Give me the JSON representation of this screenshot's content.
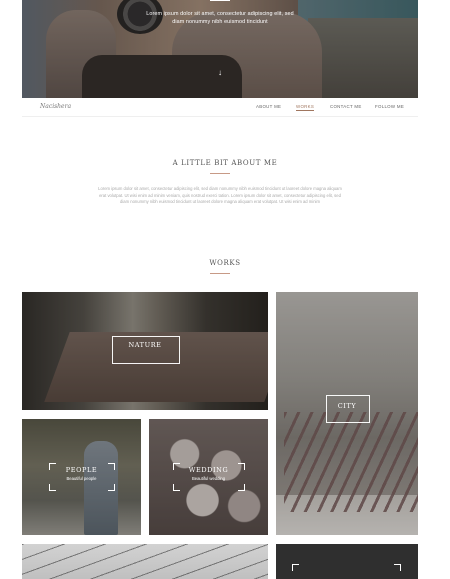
{
  "hero": {
    "text_line1": "Lorem ipsum dolor sit amet, consectetur adipiscing elit, sed",
    "text_line2": "diam nonummy nibh euismod tincidunt",
    "arrow": "↓"
  },
  "nav": {
    "logo": "Nacishera",
    "items": [
      {
        "label": "ABOUT ME"
      },
      {
        "label": "WORKS"
      },
      {
        "label": "CONTACT ME"
      },
      {
        "label": "FOLLOW ME"
      }
    ]
  },
  "about": {
    "title": "A LITTLE BIT ABOUT ME",
    "text": "Lorem ipsum dolor sit amet, consectetur adipiscing elit, sed diam nonummy nibh euismod tincidunt ut laoreet dolore magna aliquam erat volutpat. Ut wisi enim ad minim veniam, quis nostrud exerci tation. Lorem ipsum dolor sit amet, consectetur adipiscing elit, sed diam nonummy nibh euismod tincidunt ut laoreet dolore magna aliquam erat volutpat. Ut wisi enim ad minim"
  },
  "works": {
    "title": "WORKS",
    "tiles": [
      {
        "title": "NATURE",
        "subtitle": ""
      },
      {
        "title": "CITY",
        "subtitle": ""
      },
      {
        "title": "PEOPLE",
        "subtitle": "Beautiful people"
      },
      {
        "title": "WEDDING",
        "subtitle": "Beautiful wedding"
      }
    ]
  },
  "colors": {
    "accent": "#a0765f",
    "rule": "#c79a86"
  }
}
